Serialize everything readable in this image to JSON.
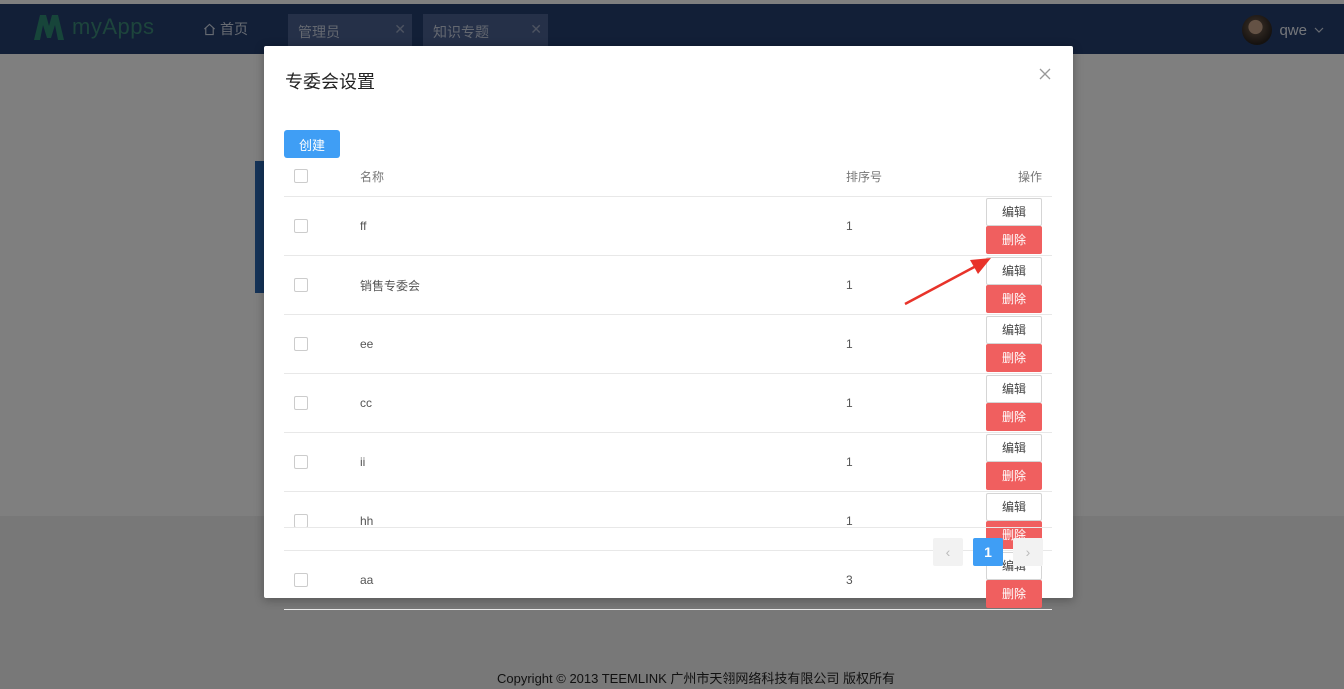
{
  "app": {
    "name": "myApps",
    "user": "qwe"
  },
  "nav": {
    "home_label": "首页",
    "tabs": [
      {
        "label": "管理员"
      },
      {
        "label": "知识专题"
      }
    ]
  },
  "dialog": {
    "title": "专委会设置",
    "create_label": "创建",
    "columns": {
      "name": "名称",
      "sort": "排序号",
      "action": "操作"
    },
    "rows": [
      {
        "name": "ff",
        "sort": "1"
      },
      {
        "name": "销售专委会",
        "sort": "1"
      },
      {
        "name": "ee",
        "sort": "1"
      },
      {
        "name": "cc",
        "sort": "1"
      },
      {
        "name": "ii",
        "sort": "1"
      },
      {
        "name": "hh",
        "sort": "1"
      },
      {
        "name": "aa",
        "sort": "3"
      }
    ],
    "edit_label": "编辑",
    "delete_label": "删除",
    "pagination": {
      "current": "1",
      "prev_icon": "chevron-left-icon",
      "next_icon": "chevron-right-icon"
    }
  },
  "footer": "Copyright © 2013 TEEMLINK 广州市天翎网络科技有限公司 版权所有",
  "colors": {
    "nav_bg": "#243e6f",
    "primary": "#3f9ef5",
    "danger": "#f05f5f",
    "annotation_arrow": "#e8332a"
  }
}
